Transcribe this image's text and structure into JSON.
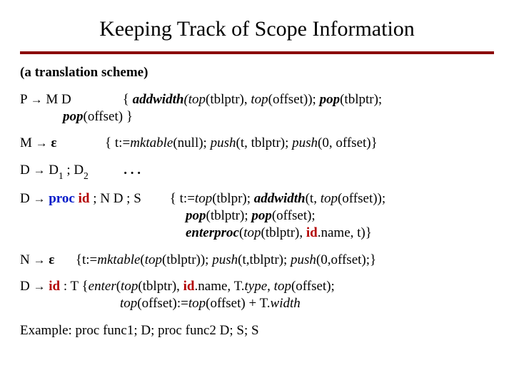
{
  "title": "Keeping Track of Scope Information",
  "subtitle": "(a translation scheme)",
  "arrow": "→",
  "eps": "ε",
  "prod_P": {
    "lhs_nt": "P",
    "rhs": "M D",
    "action_part1_open": "{",
    "action_part1_fn": "addwidth",
    "action_part1_args_a": "(top",
    "action_part1_args_b_tblptr": "(tblptr)",
    "action_part1_comma": ",",
    "action_part1_top2": " top",
    "action_part1_offset_paren": "(offset)",
    "action_part1_close_semicolon": ");",
    "action_part1_pop": " pop",
    "action_part1_pop_arg": "(tblptr);",
    "action_part2_pop": "pop",
    "action_part2_arg": "(offset) }"
  },
  "prod_M": {
    "lhs_nt": "M",
    "action_open": "{ t:=",
    "mktable": "mktable",
    "null_arg": "(null);",
    "push1": "  push",
    "push1_arg": "(t, tblptr);",
    "push2": " push",
    "push2_arg": "(0, offset)}"
  },
  "prod_D1": {
    "lhs_nt": "D",
    "d1": "D",
    "sub1": "1",
    "semi": " ; ",
    "d2": "D",
    "sub2": "2",
    "dots": ". . ."
  },
  "prod_Dproc": {
    "lhs_nt": "D",
    "kw_proc": "proc",
    "kw_id": "id",
    "rest": " ; N D ; S",
    "a_open": "{ t:=",
    "a_top": "top",
    "a_tblpr": "(tblpr);",
    "a_addwidth": " addwidth",
    "a_addwidth_args_a": "(t,",
    "a_addwidth_top": " top",
    "a_addwidth_offset": "(offset));",
    "b_pop1": "pop",
    "b_pop1_arg": "(tblptr);",
    "b_pop2": " pop",
    "b_pop2_arg": "(offset);",
    "c_enterproc": "enterproc",
    "c_args_open": "(",
    "c_top": "top",
    "c_tblptr": "(tblptr),",
    "c_id": " id",
    "c_idname": ".name, t)}"
  },
  "prod_N": {
    "lhs_nt": "N",
    "open": "{t:=",
    "mktable": "mktable",
    "mk_args_open": "(",
    "top": "top",
    "tblptr": "(tblptr));",
    "push1": " push",
    "push1_arg": "(t,tblptr);",
    "push2": " push",
    "push2_arg": "(0,offset);}"
  },
  "prod_Did": {
    "lhs_nt": "D",
    "kw_id": "id",
    "colon_T": " : T {",
    "enter": "enter",
    "enter_open": "(",
    "top": "top",
    "tblptr": "(tblptr),",
    "id2": " id",
    "idname": ".name, T.",
    "type_word": "type",
    "comma": ", ",
    "top2": "top",
    "offset1": "(offset);",
    "l2_top": "top",
    "l2_offset_assign": "(offset):=",
    "l2_top2": "top",
    "l2_offset_plus": "(offset) + T.",
    "l2_width": "width"
  },
  "example": "Example: proc func1; D; proc func2 D; S; S"
}
